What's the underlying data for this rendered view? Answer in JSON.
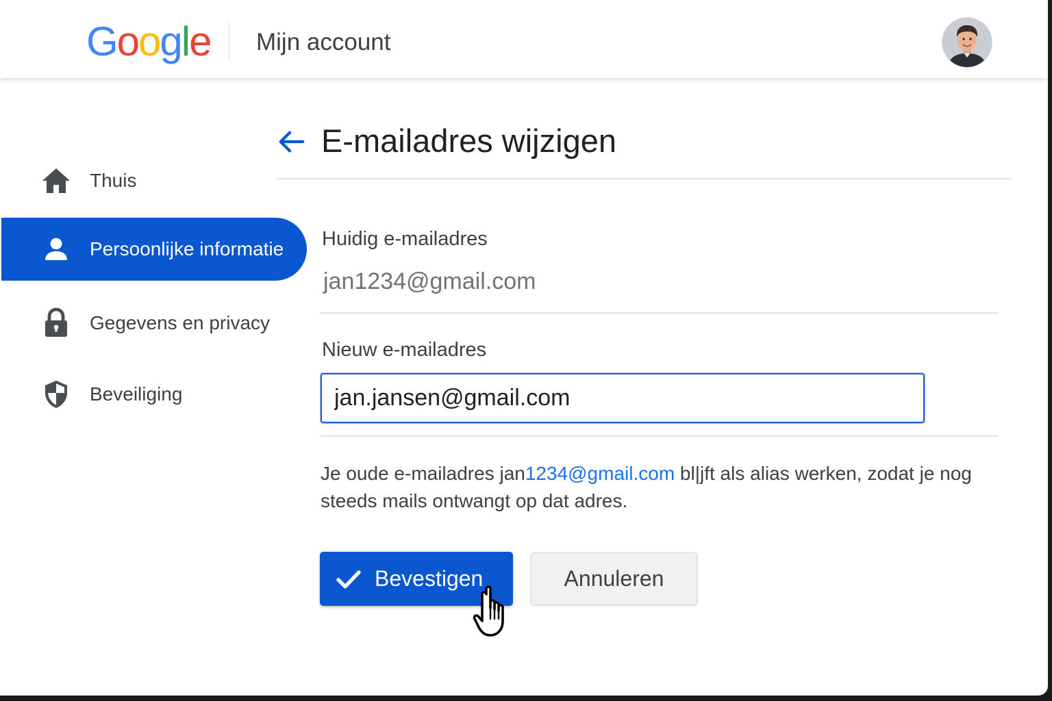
{
  "header": {
    "logo_letters": [
      {
        "char": "G",
        "color": "#4285F4"
      },
      {
        "char": "o",
        "color": "#EA4335"
      },
      {
        "char": "o",
        "color": "#FBBC05"
      },
      {
        "char": "g",
        "color": "#4285F4"
      },
      {
        "char": "l",
        "color": "#34A853"
      },
      {
        "char": "e",
        "color": "#EA4335"
      }
    ],
    "title": "Mijn account",
    "avatar_icon": "user-avatar-photo"
  },
  "sidebar": {
    "items": [
      {
        "label": "Thuis",
        "icon": "home-icon",
        "active": false
      },
      {
        "label": "Persoonlijke informatie",
        "icon": "person-icon",
        "active": true
      },
      {
        "label": "Gegevens en privacy",
        "icon": "lock-icon",
        "active": false
      },
      {
        "label": "Beveiliging",
        "icon": "shield-icon",
        "active": false
      }
    ],
    "active_color": "#0b57d0"
  },
  "main": {
    "back_icon": "arrow-back-icon",
    "title": "E-mailadres wijzigen",
    "current_label": "Huidig e-mailadres",
    "current_value": "jan1234@gmail.com",
    "new_label": "Nieuw e-mailadres",
    "new_value": "jan.jansen@gmail.com",
    "info": {
      "prefix": "Je oude e-mailadres jan",
      "link": "1234@gmail.com",
      "suffix": " bl|jft als alias werken, zodat je nog steeds mails ontwangt op dat adres."
    },
    "confirm_label": "Bevestigen",
    "confirm_icon": "check-icon",
    "cancel_label": "Annuleren",
    "accent_color": "#0b57d0",
    "link_color": "#1a73e8"
  },
  "cursor_icon": "hand-pointer-cursor"
}
